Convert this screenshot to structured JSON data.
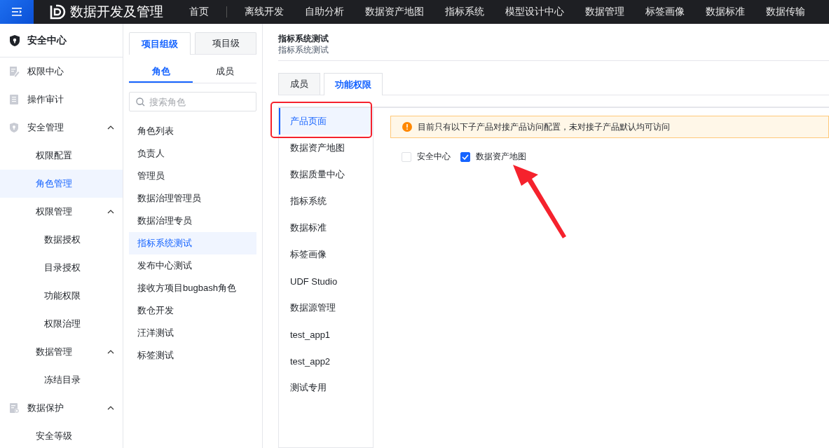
{
  "topbar": {
    "app_title": "数据开发及管理",
    "nav": [
      {
        "label": "首页",
        "selected": false
      },
      {
        "label": "离线开发",
        "selected": false
      },
      {
        "label": "自助分析",
        "selected": false
      },
      {
        "label": "数据资产地图",
        "selected": false
      },
      {
        "label": "指标系统",
        "selected": false
      },
      {
        "label": "模型设计中心",
        "selected": false
      },
      {
        "label": "数据管理",
        "selected": false
      },
      {
        "label": "标签画像",
        "selected": false
      },
      {
        "label": "数据标准",
        "selected": false
      },
      {
        "label": "数据传输",
        "selected": false
      }
    ]
  },
  "sidebar": {
    "title": "安全中心",
    "items": [
      {
        "label": "权限中心",
        "kind": "doc-edit",
        "selected": false
      },
      {
        "label": "操作审计",
        "kind": "doc",
        "selected": false
      },
      {
        "label": "安全管理",
        "kind": "shield",
        "selected": false,
        "expanded": true,
        "children": [
          {
            "label": "权限配置",
            "selected": false
          },
          {
            "label": "角色管理",
            "selected": true
          },
          {
            "label": "权限管理",
            "selected": false,
            "expanded": true,
            "children": [
              {
                "label": "数据授权",
                "selected": false
              },
              {
                "label": "目录授权",
                "selected": false
              },
              {
                "label": "功能权限",
                "selected": false
              },
              {
                "label": "权限治理",
                "selected": false
              }
            ]
          },
          {
            "label": "数据管理",
            "selected": false,
            "expanded": true,
            "children": [
              {
                "label": "冻结目录",
                "selected": false
              }
            ]
          }
        ]
      },
      {
        "label": "数据保护",
        "kind": "doc-gear",
        "selected": false,
        "expanded": true,
        "children": [
          {
            "label": "安全等级",
            "selected": false
          }
        ]
      }
    ]
  },
  "roles_panel": {
    "level_tabs": [
      {
        "label": "项目组级",
        "selected": true
      },
      {
        "label": "项目级",
        "selected": false
      }
    ],
    "sub_tabs": [
      {
        "label": "角色",
        "selected": true
      },
      {
        "label": "成员",
        "selected": false
      }
    ],
    "search": {
      "placeholder": "搜索角色"
    },
    "roles": [
      {
        "label": "角色列表",
        "selected": false
      },
      {
        "label": "负责人",
        "selected": false
      },
      {
        "label": "管理员",
        "selected": false
      },
      {
        "label": "数据治理管理员",
        "selected": false
      },
      {
        "label": "数据治理专员",
        "selected": false
      },
      {
        "label": "指标系统测试",
        "selected": true
      },
      {
        "label": "发布中心测试",
        "selected": false
      },
      {
        "label": "接收方项目bugbash角色",
        "selected": false
      },
      {
        "label": "数仓开发",
        "selected": false
      },
      {
        "label": "汪洋测试",
        "selected": false
      },
      {
        "label": "标签测试",
        "selected": false
      }
    ]
  },
  "detail": {
    "title": "指标系统测试",
    "subtitle": "指标系统测试",
    "tabs": [
      {
        "label": "成员",
        "selected": false
      },
      {
        "label": "功能权限",
        "selected": true
      }
    ],
    "products": [
      {
        "label": "产品页面",
        "selected": true
      },
      {
        "label": "数据资产地图",
        "selected": false
      },
      {
        "label": "数据质量中心",
        "selected": false
      },
      {
        "label": "指标系统",
        "selected": false
      },
      {
        "label": "数据标准",
        "selected": false
      },
      {
        "label": "标签画像",
        "selected": false
      },
      {
        "label": "UDF Studio",
        "selected": false
      },
      {
        "label": "数据源管理",
        "selected": false
      },
      {
        "label": "test_app1",
        "selected": false
      },
      {
        "label": "test_app2",
        "selected": false
      },
      {
        "label": "测试专用",
        "selected": false
      }
    ],
    "notice": "目前只有以下子产品对接产品访问配置，未对接子产品默认均可访问",
    "options": [
      {
        "label": "安全中心",
        "checked": false
      },
      {
        "label": "数据资产地图",
        "checked": true
      }
    ]
  }
}
